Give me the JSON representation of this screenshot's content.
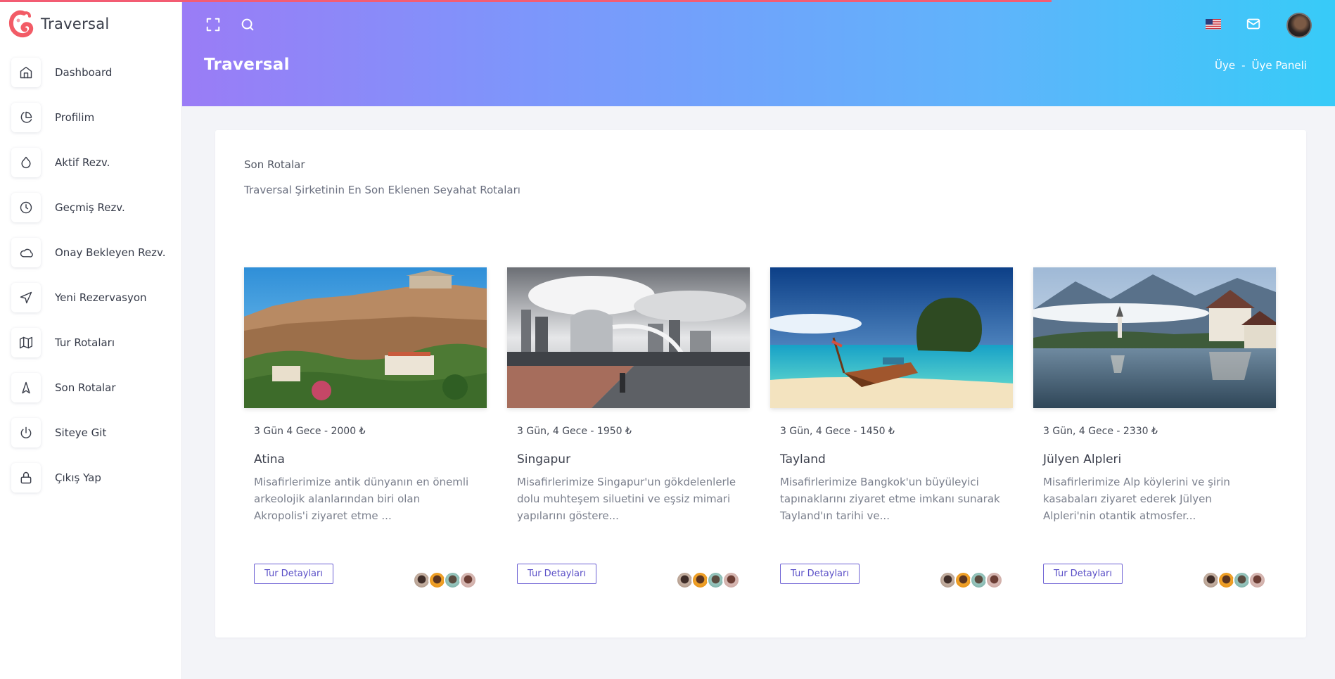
{
  "brand": {
    "name": "Traversal"
  },
  "sidebar": {
    "items": [
      {
        "label": "Dashboard",
        "icon": "home-icon"
      },
      {
        "label": "Profilim",
        "icon": "pie-chart-icon"
      },
      {
        "label": "Aktif Rezv.",
        "icon": "droplet-icon"
      },
      {
        "label": "Geçmiş Rezv.",
        "icon": "clock-icon"
      },
      {
        "label": "Onay Bekleyen Rezv.",
        "icon": "cloud-icon"
      },
      {
        "label": "Yeni Rezervasyon",
        "icon": "navigation-icon"
      },
      {
        "label": "Tur Rotaları",
        "icon": "map-icon"
      },
      {
        "label": "Son Rotalar",
        "icon": "compass-arrow-icon"
      },
      {
        "label": "Siteye Git",
        "icon": "power-icon"
      },
      {
        "label": "Çıkış Yap",
        "icon": "lock-icon"
      }
    ]
  },
  "header": {
    "title": "Traversal",
    "breadcrumb": [
      "Üye",
      "-",
      "Üye Paneli"
    ],
    "icons": [
      "fullscreen-icon",
      "search-icon",
      "us-flag-icon",
      "mail-icon",
      "user-avatar"
    ]
  },
  "colors": {
    "accent": "#6e62d4",
    "header_start": "#9a7cf6",
    "header_end": "#37cbf8",
    "progress": "#f35c73"
  },
  "main": {
    "title": "Son Rotalar",
    "subtitle": "Traversal Şirketinin En Son Eklenen Seyahat Rotaları",
    "tours": [
      {
        "meta": "3 Gün 4 Gece - 2000 ₺",
        "name": "Atina",
        "desc": "Misafirlerimize antik dünyanın en önemli arkeolojik alanlarından biri olan Akropolis'i ziyaret etme ...",
        "button": "Tur Detayları"
      },
      {
        "meta": "3 Gün, 4 Gece - 1950 ₺",
        "name": "Singapur",
        "desc": "Misafirlerimize Singapur'un gökdelenlerle dolu muhteşem siluetini ve eşsiz mimari yapılarını göstere...",
        "button": "Tur Detayları"
      },
      {
        "meta": "3 Gün, 4 Gece - 1450 ₺",
        "name": "Tayland",
        "desc": "Misafirlerimize Bangkok'un büyüleyici tapınaklarını ziyaret etme imkanı sunarak Tayland'ın tarihi ve...",
        "button": "Tur Detayları"
      },
      {
        "meta": "3 Gün, 4 Gece - 2330 ₺",
        "name": "Jülyen Alpleri",
        "desc": "Misafirlerimize Alp köylerini ve şirin kasabaları ziyaret ederek Jülyen Alpleri'nin otantik atmosfer...",
        "button": "Tur Detayları"
      }
    ]
  }
}
